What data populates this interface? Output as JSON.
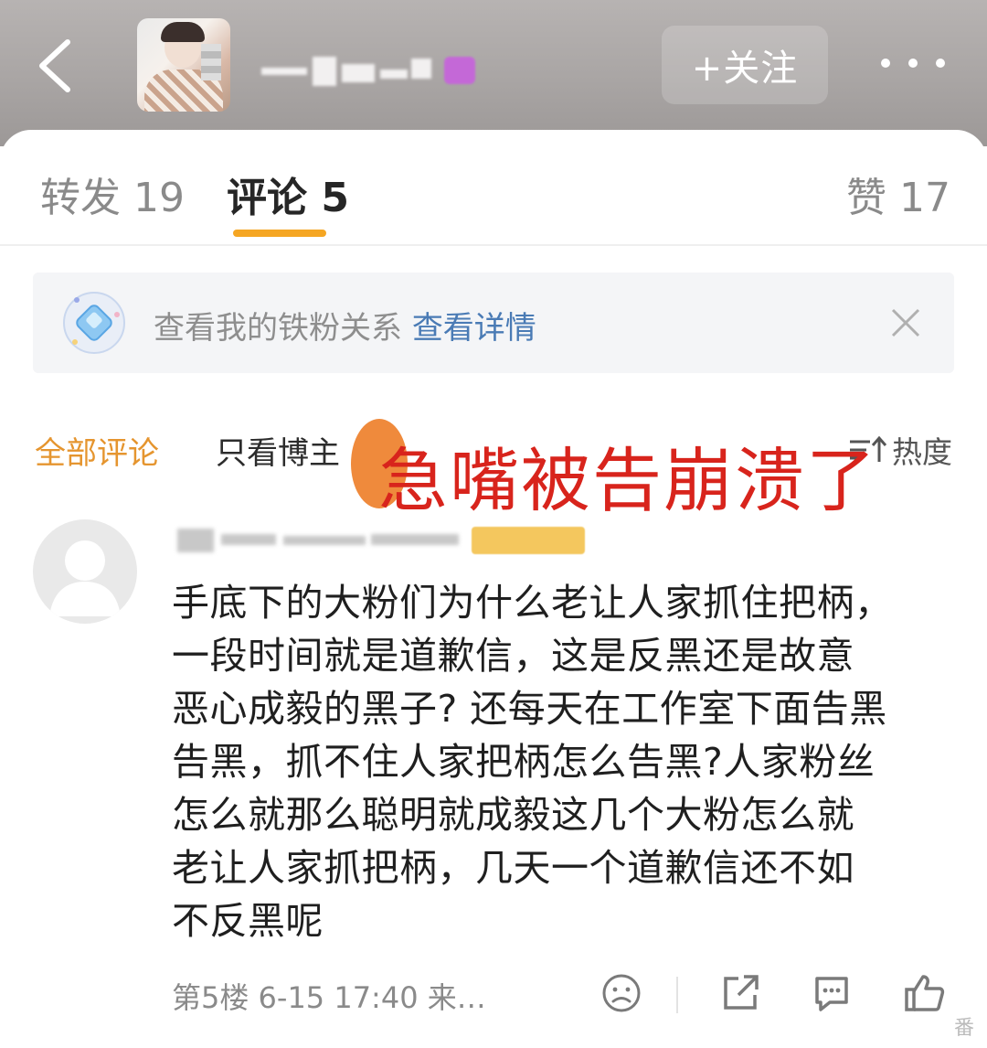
{
  "header": {
    "follow_label": "+关注"
  },
  "tabs": {
    "repost": "转发 19",
    "comment": "评论 5",
    "like": "赞 17"
  },
  "fan_banner": {
    "text": "查看我的铁粉关系",
    "link": "查看详情"
  },
  "filters": {
    "all": "全部评论",
    "owner_only": "只看博主",
    "sort": "热度"
  },
  "overlay_caption": "急嘴被告崩溃了",
  "comment": {
    "text": "手底下的大粉们为什么老让人家抓住把柄，\n一段时间就是道歉信，这是反黑还是故意\n恶心成毅的黑子? 还每天在工作室下面告黑\n告黑，抓不住人家把柄怎么告黑?人家粉丝\n怎么就那么聪明就成毅这几个大粉怎么就\n老让人家抓把柄，几天一个道歉信还不如\n不反黑呢",
    "meta": "第5楼  6-15 17:40  来…"
  },
  "colors": {
    "accent": "#f5a623",
    "active_filter": "#e5952f",
    "link": "#4a7bb5",
    "overlay": "#d8241c"
  }
}
